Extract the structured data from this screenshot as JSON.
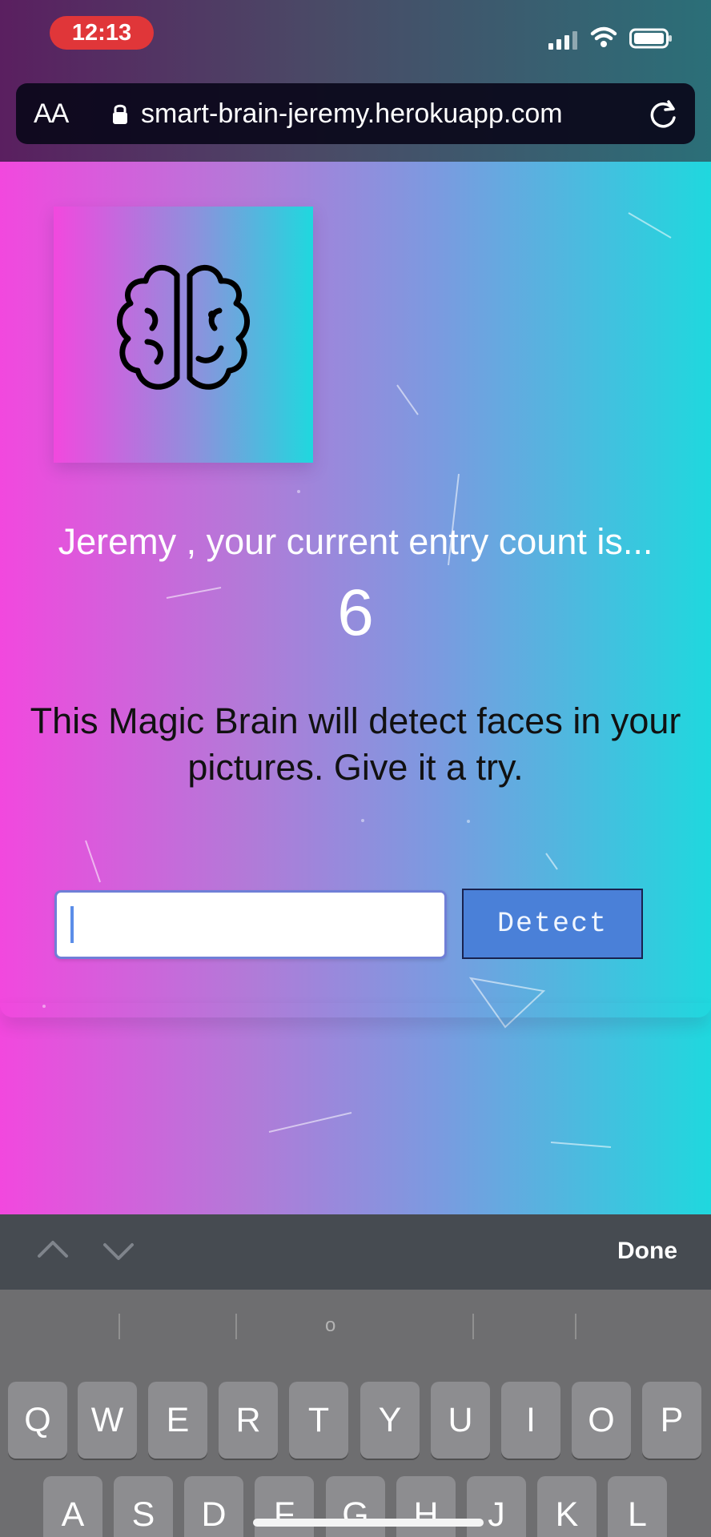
{
  "status_bar": {
    "time": "12:13",
    "signal_icon": "signal-icon",
    "wifi_icon": "wifi-icon",
    "battery_icon": "battery-icon"
  },
  "browser": {
    "text_size_label": "AA",
    "url": "smart-brain-jeremy.herokuapp.com",
    "lock_icon": "lock-icon",
    "reload_icon": "reload-icon"
  },
  "page": {
    "logo_icon": "brain-icon",
    "entry_text": "Jeremy , your current entry count is...",
    "entry_count": "6",
    "intro_text": "This Magic Brain will detect faces in your pictures. Give it a try.",
    "image_url_value": "",
    "detect_label": "Detect"
  },
  "keyboard_toolbar": {
    "up_icon": "chevron-up-icon",
    "down_icon": "chevron-down-icon",
    "done_label": "Done"
  },
  "keyboard": {
    "prediction_center": "o",
    "row1": [
      "Q",
      "W",
      "E",
      "R",
      "T",
      "Y",
      "U",
      "I",
      "O",
      "P"
    ],
    "row2": [
      "A",
      "S",
      "D",
      "F",
      "G",
      "H",
      "J",
      "K",
      "L"
    ]
  },
  "colors": {
    "background_left": "#f248de",
    "background_right": "#1fd8de",
    "detect_button": "#4a80d8",
    "status_time_pill": "#e03639",
    "keyboard": "#6e6e70"
  }
}
